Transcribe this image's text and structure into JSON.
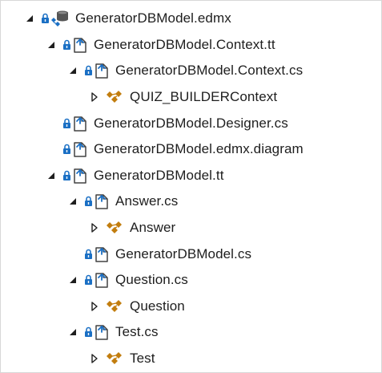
{
  "tree": {
    "items": [
      {
        "label": "GeneratorDBModel.edmx",
        "level": 0,
        "arrow": "expanded",
        "lock": true,
        "icon": "edmx-icon"
      },
      {
        "label": "GeneratorDBModel.Context.tt",
        "level": 1,
        "arrow": "expanded",
        "lock": true,
        "icon": "tt-file-icon"
      },
      {
        "label": "GeneratorDBModel.Context.cs",
        "level": 2,
        "arrow": "expanded",
        "lock": true,
        "icon": "cs-file-icon"
      },
      {
        "label": "QUIZ_BUILDERContext",
        "level": 3,
        "arrow": "collapsed",
        "lock": false,
        "icon": "class-icon"
      },
      {
        "label": "GeneratorDBModel.Designer.cs",
        "level": 1,
        "arrow": "none",
        "lock": true,
        "icon": "cs-file-icon"
      },
      {
        "label": "GeneratorDBModel.edmx.diagram",
        "level": 1,
        "arrow": "none",
        "lock": true,
        "icon": "diagram-file-icon"
      },
      {
        "label": "GeneratorDBModel.tt",
        "level": 1,
        "arrow": "expanded",
        "lock": true,
        "icon": "tt-file-icon"
      },
      {
        "label": "Answer.cs",
        "level": 2,
        "arrow": "expanded",
        "lock": true,
        "icon": "cs-file-icon"
      },
      {
        "label": "Answer",
        "level": 3,
        "arrow": "collapsed",
        "lock": false,
        "icon": "class-icon"
      },
      {
        "label": "GeneratorDBModel.cs",
        "level": 2,
        "arrow": "none",
        "lock": true,
        "icon": "cs-file-icon"
      },
      {
        "label": "Question.cs",
        "level": 2,
        "arrow": "expanded",
        "lock": true,
        "icon": "cs-file-icon"
      },
      {
        "label": "Question",
        "level": 3,
        "arrow": "collapsed",
        "lock": false,
        "icon": "class-icon"
      },
      {
        "label": "Test.cs",
        "level": 2,
        "arrow": "expanded",
        "lock": true,
        "icon": "cs-file-icon"
      },
      {
        "label": "Test",
        "level": 3,
        "arrow": "collapsed",
        "lock": false,
        "icon": "class-icon"
      }
    ]
  },
  "colors": {
    "text": "#1e1e1e",
    "arrow": "#1e1e1e",
    "lock": "#1a6fc4",
    "file_outline": "#424242",
    "file_accent": "#1a6fc4",
    "class_icon": "#c27d0e",
    "db_icon": "#555555"
  }
}
